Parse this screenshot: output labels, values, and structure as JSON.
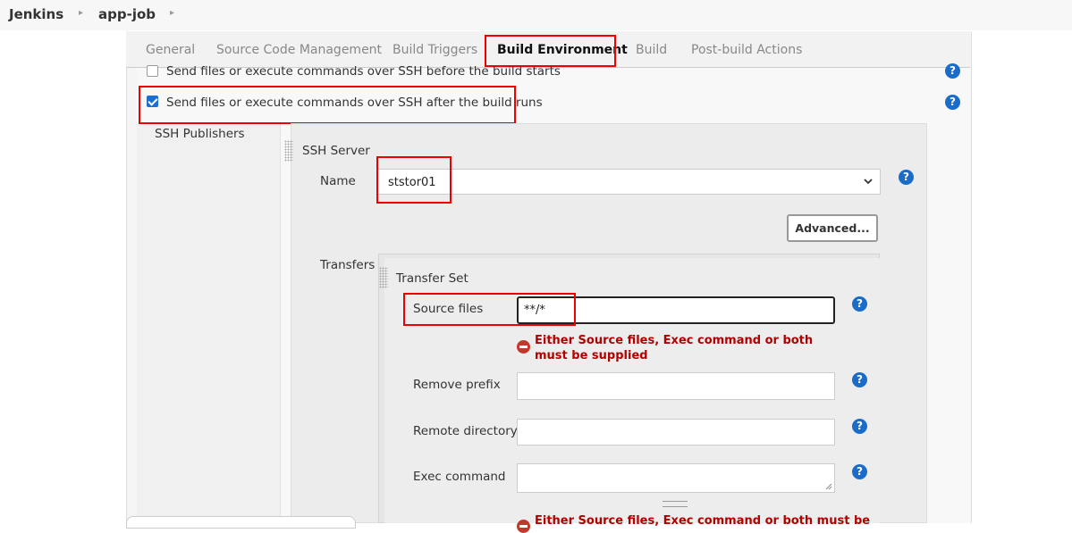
{
  "breadcrumb": {
    "items": [
      "Jenkins",
      "app-job"
    ]
  },
  "tabs": [
    {
      "label": "General"
    },
    {
      "label": "Source Code Management"
    },
    {
      "label": "Build Triggers"
    },
    {
      "label": "Build Environment",
      "active": true
    },
    {
      "label": "Build"
    },
    {
      "label": "Post-build Actions"
    }
  ],
  "options": {
    "ssh_before": {
      "label": "Send files or execute commands over SSH before the build starts",
      "checked": false
    },
    "ssh_after": {
      "label": "Send files or execute commands over SSH after the build runs",
      "checked": true
    }
  },
  "ssh_publishers": {
    "label": "SSH Publishers",
    "server_title": "SSH Server",
    "name_label": "Name",
    "name_value": "ststor01",
    "advanced_label": "Advanced...",
    "transfers_label": "Transfers",
    "transfer_set_title": "Transfer Set",
    "source_files_label": "Source files",
    "source_files_value": "**/*",
    "error_text": "Either Source files, Exec command or both must be supplied",
    "error_text_partial": "Either Source files, Exec command or both must be",
    "remove_prefix_label": "Remove prefix",
    "remove_prefix_value": "",
    "remote_directory_label": "Remote directory",
    "remote_directory_value": "",
    "exec_command_label": "Exec command",
    "exec_command_value": ""
  },
  "help_symbol": "?",
  "colors": {
    "highlight": "#ee0000",
    "help": "#1b6cc9",
    "error": "#b30000",
    "checkbox": "#1a6fd1"
  }
}
